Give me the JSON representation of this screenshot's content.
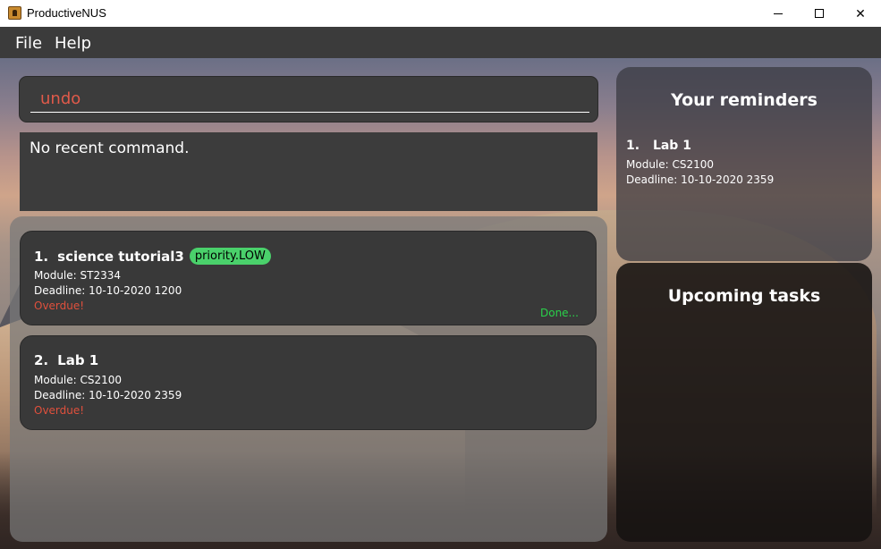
{
  "window": {
    "title": "ProductiveNUS",
    "minimize_glyph": "",
    "close_glyph": "✕"
  },
  "menu": {
    "file": "File",
    "help": "Help"
  },
  "command": {
    "value": "undo"
  },
  "result": {
    "text": "No recent command."
  },
  "tasks": [
    {
      "index": "1.",
      "name": "science tutorial3",
      "tag": "priority.LOW",
      "module": "Module: ST2334",
      "deadline": "Deadline: 10-10-2020 1200",
      "status": "Overdue!",
      "done": "Done..."
    },
    {
      "index": "2.",
      "name": "Lab 1",
      "module": "Module: CS2100",
      "deadline": "Deadline: 10-10-2020 2359",
      "status": "Overdue!"
    }
  ],
  "reminders": {
    "title": "Your reminders",
    "items": [
      {
        "index": "1.",
        "name": "Lab 1",
        "module": "Module: CS2100",
        "deadline": "Deadline: 10-10-2020 2359"
      }
    ]
  },
  "upcoming": {
    "title": "Upcoming tasks"
  },
  "colors": {
    "accent_error": "#e0503c",
    "tag_green": "#4ad16b",
    "done_green": "#2ad14a",
    "panel_dark": "#3c3c3c"
  }
}
